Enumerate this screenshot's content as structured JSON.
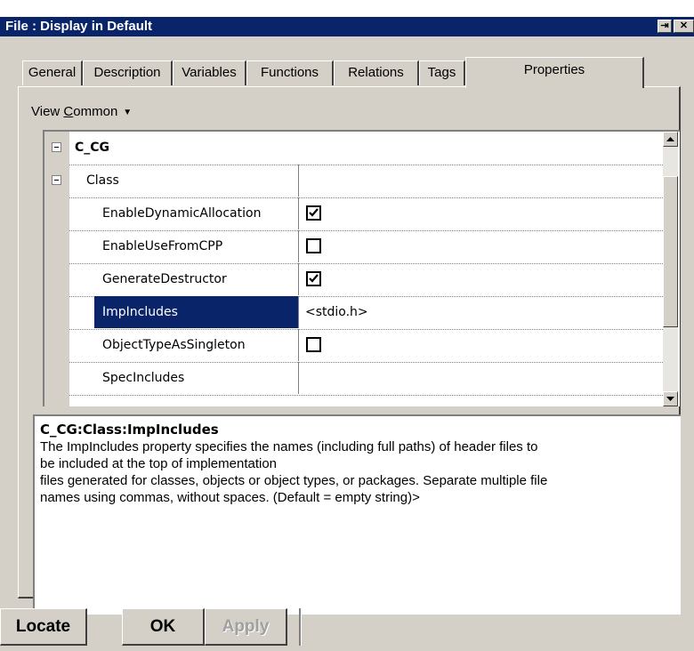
{
  "window": {
    "title": "File : Display in Default",
    "pin_icon": "pin-icon",
    "close_icon": "close-icon"
  },
  "tabs": [
    {
      "label": "General",
      "active": false
    },
    {
      "label": "Description",
      "active": false
    },
    {
      "label": "Variables",
      "active": false
    },
    {
      "label": "Functions",
      "active": false
    },
    {
      "label": "Relations",
      "active": false
    },
    {
      "label": "Tags",
      "active": false
    },
    {
      "label": "Properties",
      "active": true
    }
  ],
  "view": {
    "prefix": "View ",
    "mnemonic": "C",
    "rest": "ommon"
  },
  "grid": {
    "group": "C_CG",
    "subgroup": "Class",
    "rows": [
      {
        "name": "EnableDynamicAllocation",
        "type": "checkbox",
        "checked": true
      },
      {
        "name": "EnableUseFromCPP",
        "type": "checkbox",
        "checked": false
      },
      {
        "name": "GenerateDestructor",
        "type": "checkbox",
        "checked": true
      },
      {
        "name": "ImpIncludes",
        "type": "text",
        "value": "<stdio.h>",
        "selected": true
      },
      {
        "name": "ObjectTypeAsSingleton",
        "type": "checkbox",
        "checked": false
      },
      {
        "name": "SpecIncludes",
        "type": "text",
        "value": ""
      }
    ]
  },
  "description": {
    "heading": "C_CG:Class:ImpIncludes",
    "line1": "The ImpIncludes property specifies the names (including full paths) of header files to",
    "line2": "be included at the top of implementation",
    "line3": "files generated for classes, objects or object types, or packages. Separate multiple file",
    "line4": "names using commas, without spaces. (Default = empty string)>"
  },
  "buttons": {
    "locate": "Locate",
    "ok": "OK",
    "apply": "Apply"
  },
  "colors": {
    "titlebar": "#0a246a",
    "face": "#d4d0c8",
    "selection": "#0a246a"
  }
}
